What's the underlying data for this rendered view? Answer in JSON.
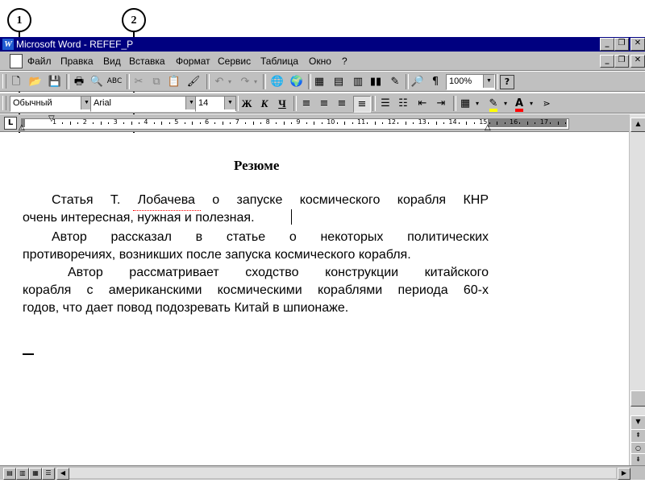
{
  "callouts": {
    "c1": "1",
    "c2": "2"
  },
  "window": {
    "title": "Microsoft Word - REFEF_P",
    "app_icon": "W"
  },
  "menu": [
    "Файл",
    "Правка",
    "Вид",
    "Вставка",
    "Формат",
    "Сервис",
    "Таблица",
    "Окно",
    "?"
  ],
  "toolbar": {
    "zoom": "100%",
    "zoom_icon": "magnifier-icon",
    "help_icon": "help-icon"
  },
  "format_bar": {
    "style": "Обычный",
    "font": "Arial",
    "size": "14",
    "bold": "Ж",
    "italic": "К",
    "underline": "Ч"
  },
  "ruler": {
    "numbers": [
      "1",
      "2",
      "3",
      "4",
      "5",
      "6",
      "7",
      "8",
      "9",
      "10",
      "11",
      "12",
      "13",
      "14",
      "15",
      "16",
      "17"
    ]
  },
  "document": {
    "title": "Резюме",
    "paragraphs": [
      [
        "Статья Т. Лобачева о запуске космического корабля КНР",
        "очень интересная, нужная и полезная."
      ],
      [
        "Автор рассказал в статье о некоторых политических",
        "противоречиях, возникших после запуска космического корабля."
      ],
      [
        "Автор рассматривает сходство конструкции китайского",
        "корабля с американскими космическими кораблями периода 60-х",
        "годов, что дает повод подозревать Китай в шпионаже."
      ]
    ]
  },
  "colors": {
    "titlebar": "#000080",
    "chrome": "#c0c0c0",
    "highlight": "#ffff00",
    "font_color": "#ff0000"
  }
}
